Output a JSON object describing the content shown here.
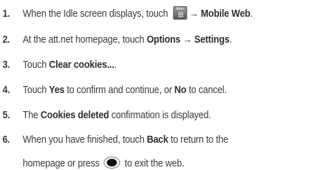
{
  "steps": [
    {
      "num": "1.",
      "pre": "When the Idle screen displays, touch",
      "icon_label": "Menu",
      "arrow": "→",
      "bold": "Mobile Web",
      "post": "."
    },
    {
      "num": "2.",
      "pre": "At the att.net homepage, touch",
      "bold1": "Options",
      "arrow": "→",
      "bold2": "Settings",
      "post": "."
    },
    {
      "num": "3.",
      "pre": "Touch",
      "bold": "Clear cookies...",
      "post": "."
    },
    {
      "num": "4.",
      "pre": "Touch",
      "bold1": "Yes",
      "mid": "to confirm and continue, or",
      "bold2": "No",
      "post": "to cancel."
    },
    {
      "num": "5.",
      "pre": "The",
      "bold": "Cookies deleted",
      "post": "confirmation is displayed."
    },
    {
      "num": "6.",
      "pre": "When you have finished, touch",
      "bold": "Back",
      "post": "to return to the",
      "line2_pre": "homepage or press",
      "line2_post": "to exit the web."
    }
  ],
  "icons": {
    "menu": "menu-key-icon",
    "home": "end-key-icon"
  }
}
